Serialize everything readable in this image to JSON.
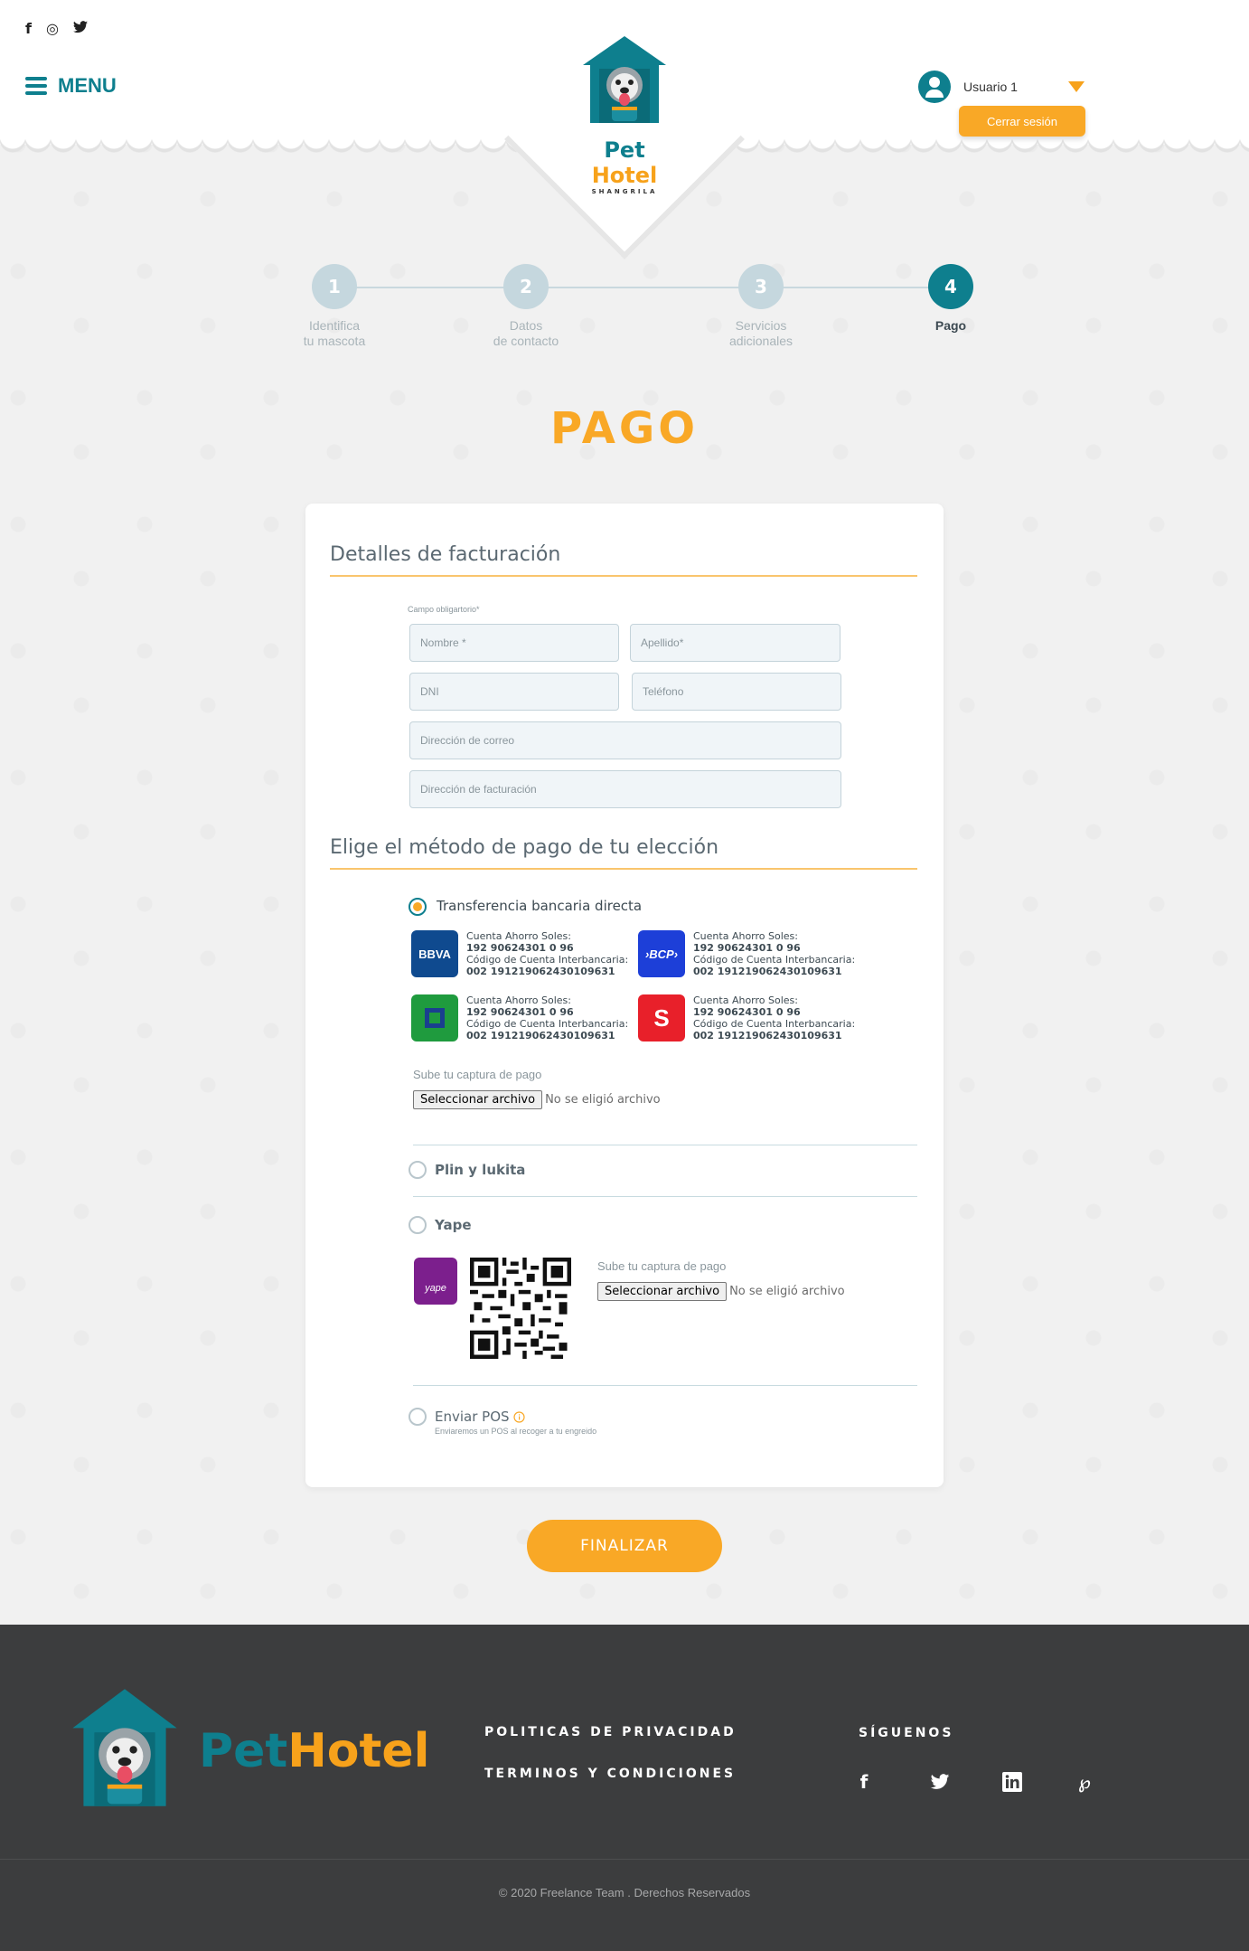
{
  "header": {
    "social": [
      "f",
      "◎",
      "🐦"
    ],
    "menu_label": "MENU",
    "logo": {
      "pet": "Pet",
      "hotel": "Hotel",
      "sub": "SHANGRILA"
    },
    "user_name": "Usuario 1",
    "logout_label": "Cerrar sesión"
  },
  "steps": [
    {
      "number": "1",
      "label_line1": "Identifica",
      "label_line2": "tu mascota"
    },
    {
      "number": "2",
      "label_line1": "Datos",
      "label_line2": "de contacto"
    },
    {
      "number": "3",
      "label_line1": "Servicios",
      "label_line2": "adicionales"
    },
    {
      "number": "4",
      "label_line1": "Pago",
      "label_line2": ""
    }
  ],
  "page_title": "PAGO",
  "billing": {
    "title": "Detalles de facturación",
    "required_note": "Campo obligartorio*",
    "fields": {
      "first_name": "Nombre *",
      "last_name": "Apellido*",
      "dni": "DNI",
      "phone": "Teléfono",
      "email": "Dirección de correo",
      "address": "Dirección de facturación"
    }
  },
  "payment": {
    "title": "Elige el método de pago de tu elección",
    "transfer": {
      "label": "Transferencia bancaria directa",
      "banks": [
        {
          "logo": "BBVA",
          "color": "#0f4a8f",
          "line1": "Cuenta Ahorro Soles:",
          "line2": "192 90624301 0 96",
          "line3": "Código de Cuenta Interbancaria:",
          "line4": "002 191219062430109631"
        },
        {
          "logo": "›BCP›",
          "color": "#1d3fd8",
          "line1": "Cuenta Ahorro Soles:",
          "line2": "192 90624301 0 96",
          "line3": "Código de Cuenta Interbancaria:",
          "line4": "002 191219062430109631"
        },
        {
          "logo": "",
          "color": "#1f9b3e",
          "line1": "Cuenta Ahorro Soles:",
          "line2": "192 90624301 0 96",
          "line3": "Código de Cuenta Interbancaria:",
          "line4": "002 191219062430109631"
        },
        {
          "logo": "S",
          "color": "#e8202a",
          "line1": "Cuenta Ahorro Soles:",
          "line2": "192 90624301 0 96",
          "line3": "Código de Cuenta Interbancaria:",
          "line4": "002 191219062430109631"
        }
      ],
      "upload_label": "Sube tu captura de pago",
      "file_button": "Seleccionar archivo",
      "file_none": "No se eligió archivo"
    },
    "plin": {
      "label": "Plin y lukita"
    },
    "yape": {
      "label": "Yape",
      "logo": "yape",
      "upload_label": "Sube tu captura de pago",
      "file_button": "Seleccionar archivo",
      "file_none": "No se eligió archivo"
    },
    "pos": {
      "label": "Enviar POS",
      "sub": "Enviaremos un POS al recoger a tu engreido"
    }
  },
  "finalize_label": "FINALIZAR",
  "footer": {
    "logo": {
      "pet": "Pet",
      "hotel": "Hotel"
    },
    "links": [
      "POLITICAS DE PRIVACIDAD",
      "TERMINOS Y CONDICIONES"
    ],
    "follow_label": "SÍGUENOS",
    "social": [
      "f",
      "🐦",
      "in",
      "℘"
    ],
    "copyright": "© 2020 Freelance Team . Derechos Reservados"
  },
  "colors": {
    "primary": "#0e7f8e",
    "accent": "#f9a826",
    "footer_bg": "#3c3d3e"
  }
}
